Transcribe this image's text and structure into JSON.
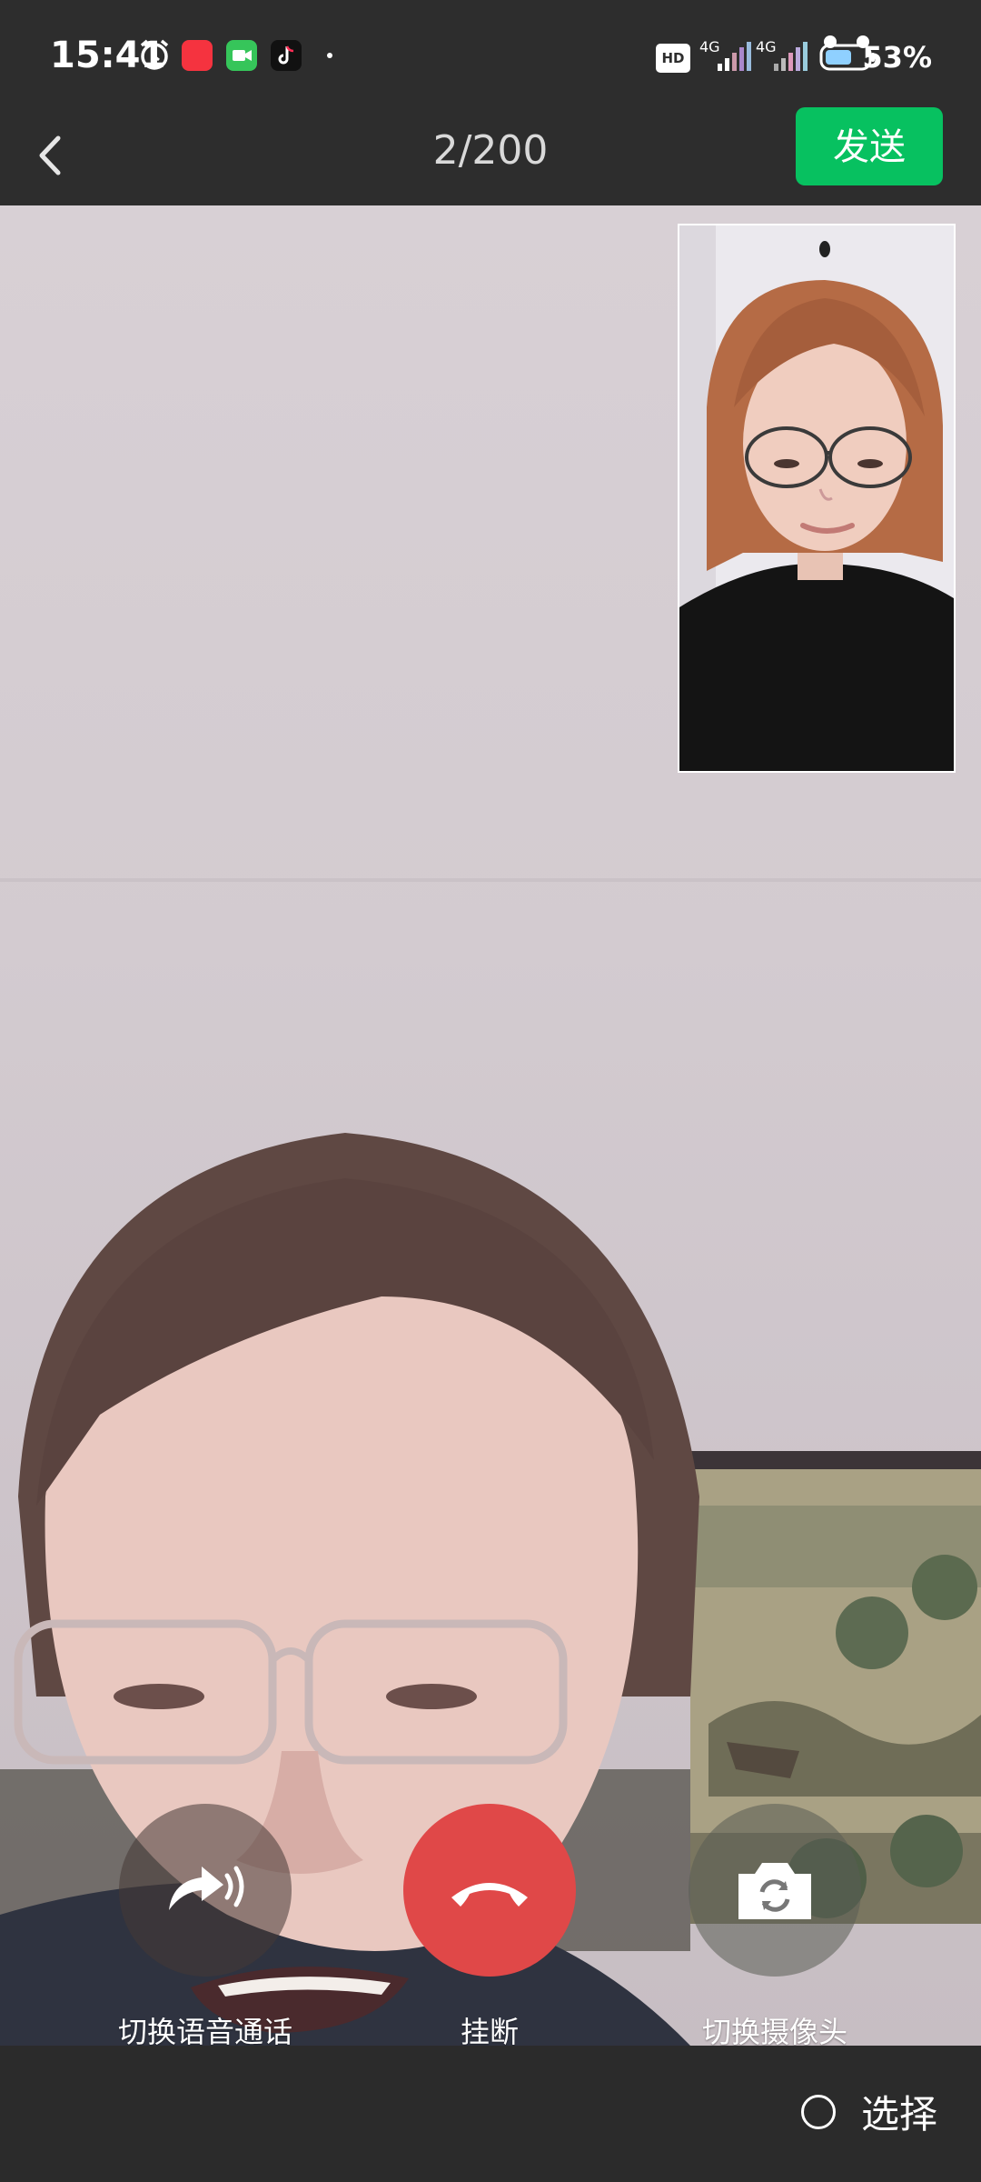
{
  "status_bar": {
    "time": "15:41",
    "battery_percent": "53%",
    "network": "4G",
    "network2": "4G",
    "hd": "HD",
    "icons": [
      "alarm-icon",
      "xiaohongshu-app-icon",
      "facetime-app-icon",
      "tiktok-app-icon",
      "dot-icon",
      "hd-icon",
      "signal-icon",
      "signal-icon",
      "battery-icon"
    ]
  },
  "header": {
    "back_icon": "chevron-left-icon",
    "counter": "2/200",
    "send_label": "发送"
  },
  "controls": {
    "voice_switch_label": "切换语音通话",
    "hangup_label": "挂断",
    "camera_switch_label": "切换摄像头"
  },
  "bottom": {
    "select_label": "选择"
  },
  "colors": {
    "accent": "#07c160",
    "hangup": "#e04848",
    "bar": "#2d2d2d"
  }
}
